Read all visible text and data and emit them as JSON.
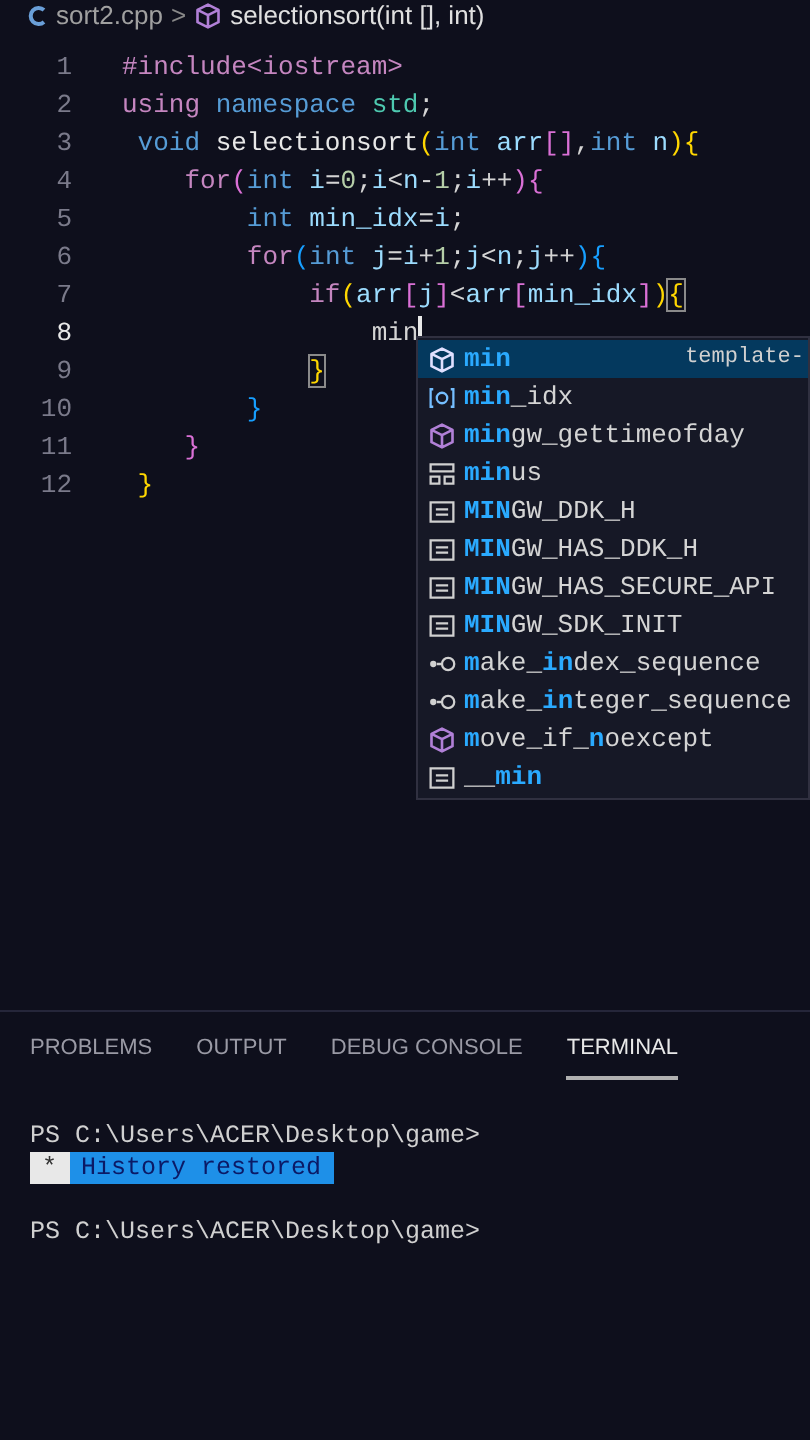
{
  "breadcrumb": {
    "file": "sort2.cpp",
    "separator": ">",
    "symbol": "selectionsort(int [], int)"
  },
  "editor": {
    "lines": [
      {
        "number": "1",
        "active": false,
        "tokens": [
          {
            "kind": "keyword",
            "text": "#include<iostream>"
          }
        ]
      },
      {
        "number": "2",
        "active": false,
        "tokens": [
          {
            "kind": "keyword",
            "text": "using"
          },
          {
            "kind": "type",
            "text": " namespace"
          },
          {
            "kind": "namespace",
            "text": " std"
          },
          {
            "kind": "plain",
            "text": ";"
          }
        ]
      },
      {
        "number": "3",
        "active": false,
        "tokens": [
          {
            "kind": "type",
            "text": " void"
          },
          {
            "kind": "function",
            "text": " selectionsort"
          },
          {
            "kind": "bracket1",
            "text": "("
          },
          {
            "kind": "type",
            "text": "int"
          },
          {
            "kind": "variable",
            "text": " arr"
          },
          {
            "kind": "bracket2",
            "text": "[]"
          },
          {
            "kind": "plain",
            "text": ","
          },
          {
            "kind": "type",
            "text": "int"
          },
          {
            "kind": "variable",
            "text": " n"
          },
          {
            "kind": "bracket1",
            "text": "){"
          }
        ]
      },
      {
        "number": "4",
        "active": false,
        "tokens": [
          {
            "kind": "keyword",
            "text": "    for"
          },
          {
            "kind": "bracket2",
            "text": "("
          },
          {
            "kind": "type",
            "text": "int"
          },
          {
            "kind": "variable",
            "text": " i"
          },
          {
            "kind": "plain",
            "text": "="
          },
          {
            "kind": "number",
            "text": "0"
          },
          {
            "kind": "plain",
            "text": ";"
          },
          {
            "kind": "variable",
            "text": "i"
          },
          {
            "kind": "plain",
            "text": "<"
          },
          {
            "kind": "variable",
            "text": "n"
          },
          {
            "kind": "plain",
            "text": "-"
          },
          {
            "kind": "number",
            "text": "1"
          },
          {
            "kind": "plain",
            "text": ";"
          },
          {
            "kind": "variable",
            "text": "i"
          },
          {
            "kind": "plain",
            "text": "++"
          },
          {
            "kind": "bracket2",
            "text": "){"
          }
        ]
      },
      {
        "number": "5",
        "active": false,
        "tokens": [
          {
            "kind": "type",
            "text": "        int"
          },
          {
            "kind": "variable",
            "text": " min_idx"
          },
          {
            "kind": "plain",
            "text": "="
          },
          {
            "kind": "variable",
            "text": "i"
          },
          {
            "kind": "plain",
            "text": ";"
          }
        ]
      },
      {
        "number": "6",
        "active": false,
        "tokens": [
          {
            "kind": "keyword",
            "text": "        for"
          },
          {
            "kind": "bracket3",
            "text": "("
          },
          {
            "kind": "type",
            "text": "int"
          },
          {
            "kind": "variable",
            "text": " j"
          },
          {
            "kind": "plain",
            "text": "="
          },
          {
            "kind": "variable",
            "text": "i"
          },
          {
            "kind": "plain",
            "text": "+"
          },
          {
            "kind": "number",
            "text": "1"
          },
          {
            "kind": "plain",
            "text": ";"
          },
          {
            "kind": "variable",
            "text": "j"
          },
          {
            "kind": "plain",
            "text": "<"
          },
          {
            "kind": "variable",
            "text": "n"
          },
          {
            "kind": "plain",
            "text": ";"
          },
          {
            "kind": "variable",
            "text": "j"
          },
          {
            "kind": "plain",
            "text": "++"
          },
          {
            "kind": "bracket3",
            "text": "){"
          }
        ]
      },
      {
        "number": "7",
        "active": false,
        "tokens": [
          {
            "kind": "keyword",
            "text": "            if"
          },
          {
            "kind": "bracket1",
            "text": "("
          },
          {
            "kind": "variable",
            "text": "arr"
          },
          {
            "kind": "bracket2",
            "text": "["
          },
          {
            "kind": "variable",
            "text": "j"
          },
          {
            "kind": "bracket2",
            "text": "]"
          },
          {
            "kind": "plain",
            "text": "<"
          },
          {
            "kind": "variable",
            "text": "arr"
          },
          {
            "kind": "bracket2",
            "text": "["
          },
          {
            "kind": "variable",
            "text": "min_idx"
          },
          {
            "kind": "bracket2",
            "text": "]"
          },
          {
            "kind": "bracket1",
            "text": ")"
          },
          {
            "kind": "matched",
            "text": "{"
          }
        ]
      },
      {
        "number": "8",
        "active": true,
        "tokens": [
          {
            "kind": "plain",
            "text": "                min"
          }
        ]
      },
      {
        "number": "9",
        "active": false,
        "tokens": [
          {
            "kind": "matched",
            "text": "            }"
          }
        ]
      },
      {
        "number": "10",
        "active": false,
        "tokens": [
          {
            "kind": "bracket3",
            "text": "        }"
          }
        ]
      },
      {
        "number": "11",
        "active": false,
        "tokens": [
          {
            "kind": "bracket2",
            "text": "    }"
          }
        ]
      },
      {
        "number": "12",
        "active": false,
        "tokens": [
          {
            "kind": "bracket1",
            "text": " }"
          }
        ]
      }
    ]
  },
  "suggestions": [
    {
      "kind": "class",
      "selected": true,
      "label": "**min**",
      "detail": "template-"
    },
    {
      "kind": "variable",
      "selected": false,
      "label": "**min**_idx"
    },
    {
      "kind": "function",
      "selected": false,
      "label": "**min**gw_gettimeofday"
    },
    {
      "kind": "struct",
      "selected": false,
      "label": "**min**us"
    },
    {
      "kind": "constant",
      "selected": false,
      "label": "**MIN**GW_DDK_H"
    },
    {
      "kind": "constant",
      "selected": false,
      "label": "**MIN**GW_HAS_DDK_H"
    },
    {
      "kind": "constant",
      "selected": false,
      "label": "**MIN**GW_HAS_SECURE_API"
    },
    {
      "kind": "constant",
      "selected": false,
      "label": "**MIN**GW_SDK_INIT"
    },
    {
      "kind": "typeparam",
      "selected": false,
      "label": "**m**ake_**in**dex_sequence"
    },
    {
      "kind": "typeparam",
      "selected": false,
      "label": "**m**ake_**in**teger_sequence"
    },
    {
      "kind": "function",
      "selected": false,
      "label": "**m**ove_if_**n**oexcept"
    },
    {
      "kind": "constant",
      "selected": false,
      "label": "__**min**"
    }
  ],
  "panel": {
    "tabs": [
      {
        "label": "PROBLEMS",
        "selected": false
      },
      {
        "label": "OUTPUT",
        "selected": false
      },
      {
        "label": "DEBUG CONSOLE",
        "selected": false
      },
      {
        "label": "TERMINAL",
        "selected": true
      }
    ],
    "terminal": [
      {
        "kind": "prompt",
        "text": "PS C:\\Users\\ACER\\Desktop\\game>"
      },
      {
        "kind": "notice",
        "mark": "*",
        "text": "History restored"
      },
      {
        "kind": "blank"
      },
      {
        "kind": "prompt",
        "text": "PS C:\\Users\\ACER\\Desktop\\game>"
      }
    ]
  }
}
